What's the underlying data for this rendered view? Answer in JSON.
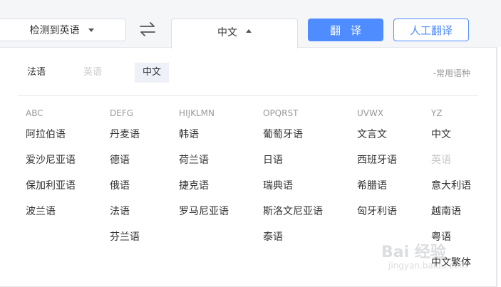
{
  "toolbar": {
    "source_lang": "检测到英语",
    "target_lang": "中文",
    "translate_label": "翻译",
    "human_translate_label": "人工翻译"
  },
  "common": {
    "items": [
      {
        "label": "法语",
        "state": "normal"
      },
      {
        "label": "英语",
        "state": "disabled"
      },
      {
        "label": "中文",
        "state": "selected"
      }
    ],
    "tag": "-常用语种"
  },
  "columns": [
    {
      "header": "ABC",
      "langs": [
        {
          "label": "阿拉伯语"
        },
        {
          "label": "爱沙尼亚语"
        },
        {
          "label": "保加利亚语"
        },
        {
          "label": "波兰语"
        }
      ]
    },
    {
      "header": "DEFG",
      "langs": [
        {
          "label": "丹麦语"
        },
        {
          "label": "德语"
        },
        {
          "label": "俄语"
        },
        {
          "label": "法语"
        },
        {
          "label": "芬兰语"
        }
      ]
    },
    {
      "header": "HIJKLMN",
      "langs": [
        {
          "label": "韩语"
        },
        {
          "label": "荷兰语"
        },
        {
          "label": "捷克语"
        },
        {
          "label": "罗马尼亚语"
        }
      ]
    },
    {
      "header": "OPQRST",
      "langs": [
        {
          "label": "葡萄牙语"
        },
        {
          "label": "日语"
        },
        {
          "label": "瑞典语"
        },
        {
          "label": "斯洛文尼亚语"
        },
        {
          "label": "泰语"
        }
      ]
    },
    {
      "header": "UVWX",
      "langs": [
        {
          "label": "文言文"
        },
        {
          "label": "西班牙语"
        },
        {
          "label": "希腊语"
        },
        {
          "label": "匈牙利语"
        }
      ]
    },
    {
      "header": "YZ",
      "langs": [
        {
          "label": "中文"
        },
        {
          "label": "英语",
          "disabled": true
        },
        {
          "label": "意大利语"
        },
        {
          "label": "越南语"
        },
        {
          "label": "粤语"
        },
        {
          "label": "中文繁体"
        }
      ]
    }
  ],
  "watermark": {
    "text": "Bai 经验",
    "sub": "jingyan.baidu.com"
  },
  "colors": {
    "accent": "#4e8cff",
    "disabled": "#c8c8c8",
    "selected_bg": "#eef1f8"
  }
}
